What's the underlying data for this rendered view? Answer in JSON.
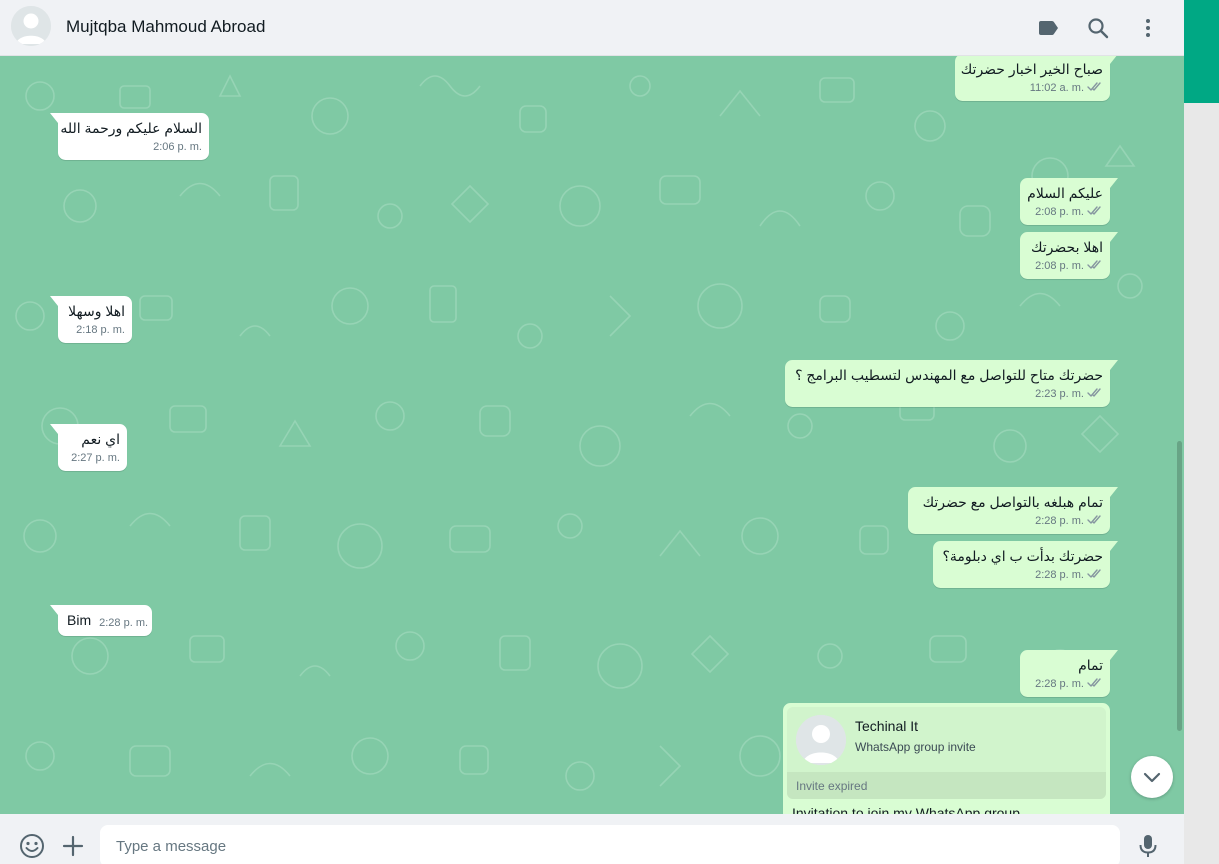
{
  "header": {
    "contact_name": "Mujtqba Mahmoud Abroad",
    "icons": [
      "label-icon",
      "search-icon",
      "menu-icon"
    ]
  },
  "messages": [
    {
      "dir": "out",
      "text": "صباح الخير اخبار حضرتك",
      "time": "11:02 a. m.",
      "ticks": true
    },
    {
      "dir": "in",
      "text": "السلام عليكم ورحمة الله",
      "time": "2:06 p. m."
    },
    {
      "dir": "out",
      "text": "عليكم السلام",
      "time": "2:08 p. m.",
      "ticks": true
    },
    {
      "dir": "out",
      "text": "اهلا بحضرتك",
      "time": "2:08 p. m.",
      "ticks": true
    },
    {
      "dir": "in",
      "text": "اهلا وسهلا",
      "time": "2:18 p. m."
    },
    {
      "dir": "out",
      "text": "حضرتك متاح للتواصل مع المهندس لتسطيب البرامج ؟",
      "time": "2:23 p. m.",
      "ticks": true
    },
    {
      "dir": "in",
      "text": "اي نعم",
      "time": "2:27 p. m."
    },
    {
      "dir": "out",
      "text": "تمام هبلغه بالتواصل مع حضرتك",
      "time": "2:28 p. m.",
      "ticks": true
    },
    {
      "dir": "out",
      "text": "حضرتك بدأت ب اي دبلومة؟",
      "time": "2:28 p. m.",
      "ticks": true
    },
    {
      "dir": "in",
      "text": "Bim",
      "time": "2:28 p. m."
    },
    {
      "dir": "out",
      "text": "تمام",
      "time": "2:28 p. m.",
      "ticks": true
    }
  ],
  "invite": {
    "group_name": "Techinal It",
    "subtitle": "WhatsApp group invite",
    "status": "Invite expired",
    "caption": "Invitation to join my WhatsApp group"
  },
  "composer": {
    "placeholder": "Type a message",
    "value": ""
  },
  "colors": {
    "accent": "#00a884",
    "chat_bg": "#7fc9a4",
    "bubble_out": "#d9fdd3",
    "bubble_in": "#ffffff"
  }
}
